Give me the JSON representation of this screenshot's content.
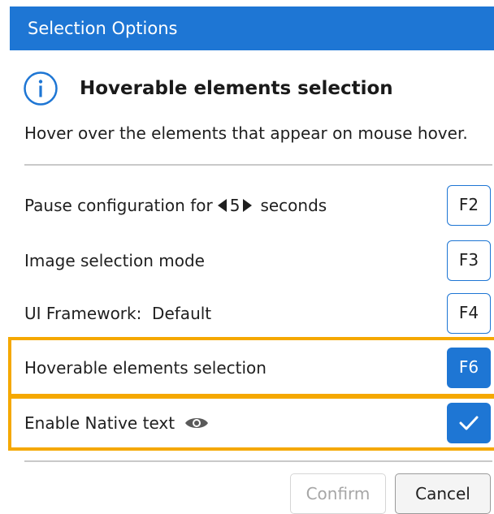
{
  "window": {
    "title": "Selection Options"
  },
  "header": {
    "title": "Hoverable elements selection",
    "icon": "info-icon"
  },
  "description": "Hover over the elements that appear on mouse hover.",
  "options": {
    "pause": {
      "prefix": "Pause configuration for",
      "value": "5",
      "suffix": "seconds",
      "key": "F2"
    },
    "image_mode": {
      "label": "Image selection mode",
      "key": "F3"
    },
    "ui_framework": {
      "label": "UI Framework:  Default",
      "key": "F4"
    },
    "hoverable": {
      "label": "Hoverable elements selection",
      "key": "F6",
      "active": true
    },
    "native_text": {
      "label": "Enable Native text",
      "icon": "eye-icon",
      "checked": true
    }
  },
  "footer": {
    "confirm_label": "Confirm",
    "confirm_enabled": false,
    "cancel_label": "Cancel"
  },
  "colors": {
    "accent": "#1e76d4",
    "highlight": "#f5a800",
    "divider": "#c9c9c9"
  }
}
